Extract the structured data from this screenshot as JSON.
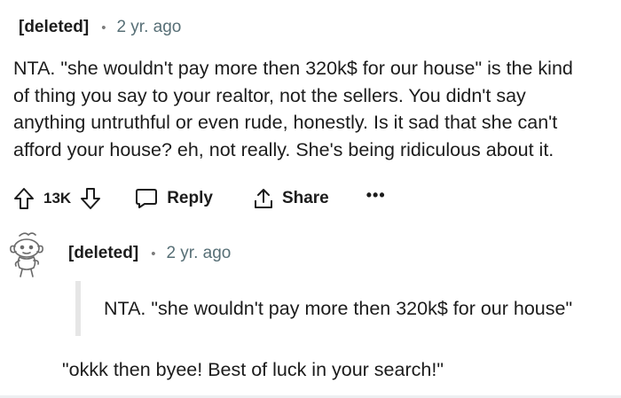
{
  "comment": {
    "author": "[deleted]",
    "separator": "•",
    "time": "2 yr. ago",
    "body_lines": [
      "NTA. \"she wouldn't pay more then 320k$ for our house\" is the kind",
      "of thing you say to your realtor, not the sellers. You didn't say",
      "anything untruthful or even rude, honestly. Is it sad that she can't",
      "afford your house? eh, not really. She's being ridiculous about it."
    ],
    "actions": {
      "upvote_icon": "upvote-arrow-icon",
      "score": "13K",
      "downvote_icon": "downvote-arrow-icon",
      "reply_icon": "speech-bubble-icon",
      "reply_label": "Reply",
      "share_icon": "share-upload-icon",
      "share_label": "Share",
      "more_label": "•••"
    }
  },
  "reply": {
    "avatar_icon": "snoo-avatar-icon",
    "author": "[deleted]",
    "separator": "•",
    "time": "2 yr. ago",
    "quote": "NTA. \"she wouldn't pay more then 320k$ for our house\"",
    "text": "\"okkk then byee! Best of luck in your search!\""
  }
}
